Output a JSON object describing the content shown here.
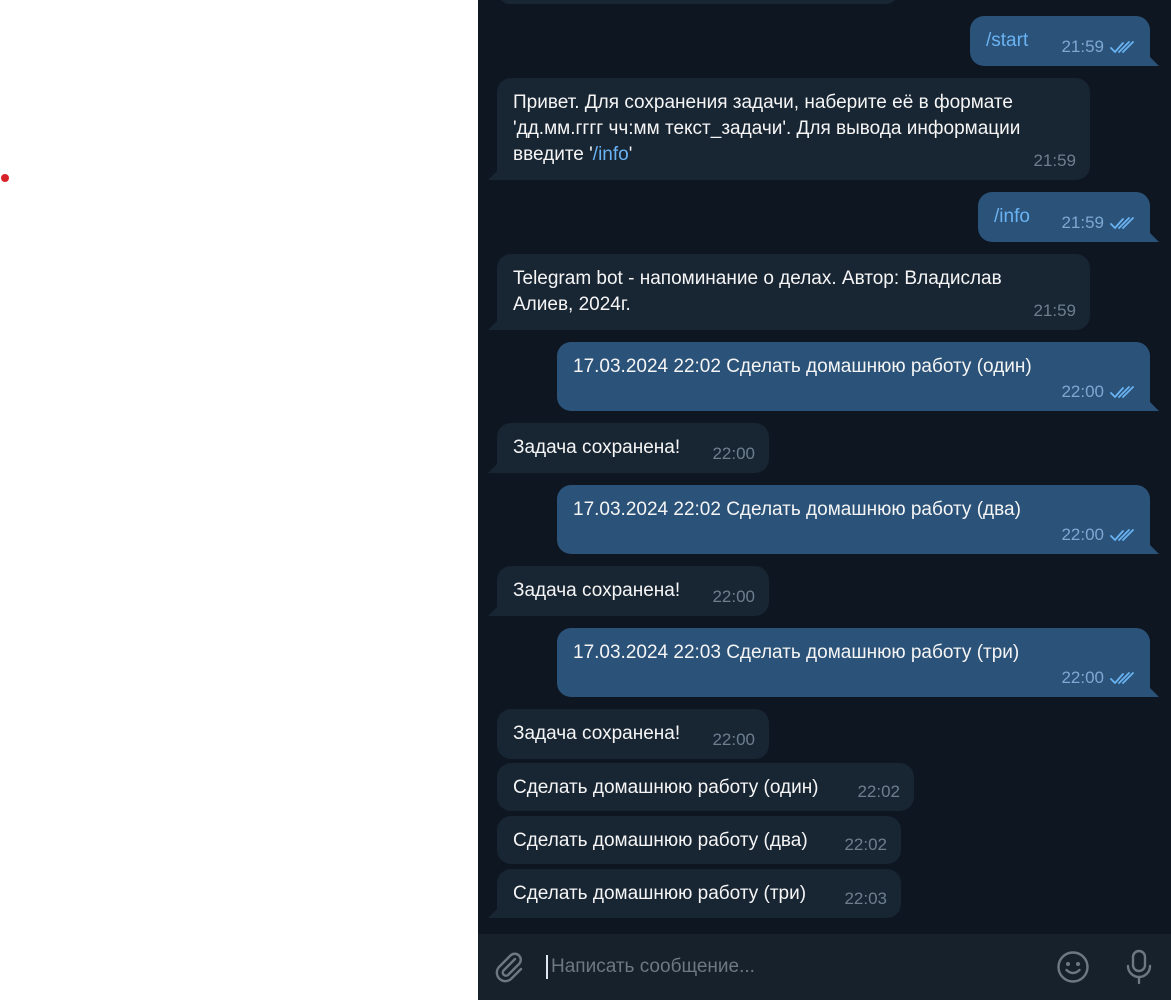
{
  "messages": [
    {
      "dir": "out",
      "text": "/start",
      "command": true,
      "time": "21:59",
      "read": true
    },
    {
      "dir": "in",
      "text": "Привет. Для сохранения задачи, наберите её в формате\n'дд.мм.гггг чч:мм текст_задачи'. Для вывода информации\nвведите '",
      "link": "/info",
      "after": "'",
      "time": "21:59"
    },
    {
      "dir": "out",
      "text": "/info",
      "command": true,
      "time": "21:59",
      "read": true
    },
    {
      "dir": "in",
      "text": "Telegram bot - напоминание о делах. Автор: Владислав\nАлиев, 2024г.",
      "time": "21:59"
    },
    {
      "dir": "out",
      "text": "17.03.2024 22:02 Сделать домашнюю работу (один)",
      "time": "22:00",
      "read": true
    },
    {
      "dir": "in",
      "text": "Задача сохранена!",
      "time": "22:00"
    },
    {
      "dir": "out",
      "text": "17.03.2024 22:02 Сделать домашнюю работу (два)",
      "time": "22:00",
      "read": true
    },
    {
      "dir": "in",
      "text": "Задача сохранена!",
      "time": "22:00"
    },
    {
      "dir": "out",
      "text": "17.03.2024 22:03 Сделать домашнюю работу (три)",
      "time": "22:00",
      "read": true
    },
    {
      "dir": "in",
      "text": "Задача сохранена!",
      "time": "22:00"
    },
    {
      "dir": "in",
      "text": "Сделать домашнюю работу (один)",
      "time": "22:02"
    },
    {
      "dir": "in",
      "text": "Сделать домашнюю работу (два)",
      "time": "22:02"
    },
    {
      "dir": "in",
      "text": "Сделать домашнюю работу (три)",
      "time": "22:03"
    }
  ],
  "composer": {
    "placeholder": "Написать сообщение...",
    "attach_icon": "paperclip-icon",
    "emoji_icon": "smiley-icon",
    "mic_icon": "microphone-icon"
  },
  "colors": {
    "chat_bg": "#0e1621",
    "incoming_bubble": "#182533",
    "outgoing_bubble": "#2b5278",
    "link": "#6ab3f3",
    "composer_bg": "#17212b"
  }
}
